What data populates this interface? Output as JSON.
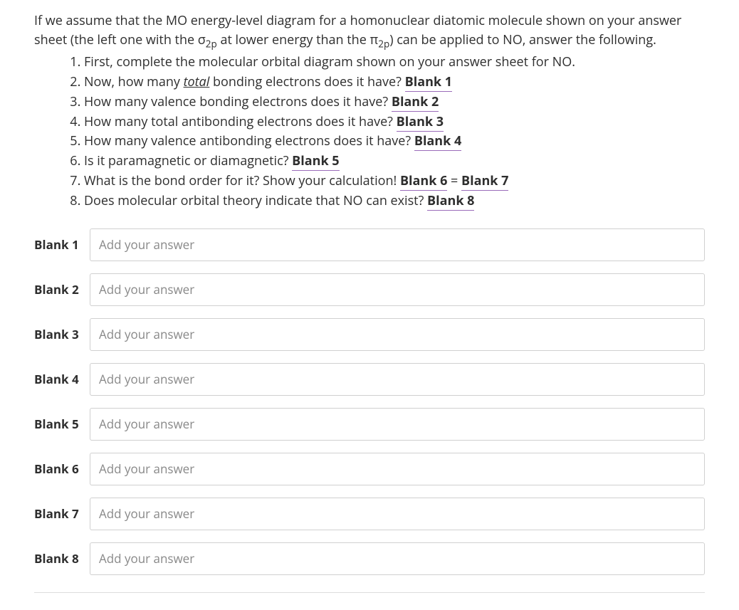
{
  "intro": {
    "line1_pre": "If we assume that the MO energy-level diagram for a homonuclear diatomic molecule shown on your answer sheet (the left one with the σ",
    "line1_sub1": "2p",
    "line1_mid": " at lower energy than the π",
    "line1_sub2": "2p",
    "line1_post": ") can be applied to NO, answer the following."
  },
  "questions": [
    {
      "pre": "First, complete the molecular orbital diagram shown on your answer sheet for NO.",
      "blank": null
    },
    {
      "pre": "Now, how many ",
      "ul_italic": "total",
      "mid": " bonding electrons does it have? ",
      "blank": "Blank 1"
    },
    {
      "pre": "How many valence bonding electrons does it have? ",
      "blank": "Blank 2"
    },
    {
      "pre": "How many total antibonding electrons does it have? ",
      "blank": "Blank 3"
    },
    {
      "pre": "How many valence antibonding electrons does it have? ",
      "blank": "Blank 4"
    },
    {
      "pre": "Is it paramagnetic or diamagnetic? ",
      "blank": "Blank 5"
    },
    {
      "pre": "What is the bond order for it? Show your calculation! ",
      "blank": "Blank 6",
      "sep": " = ",
      "blank2": "Blank 7"
    },
    {
      "pre": "Does molecular orbital theory indicate that NO can exist? ",
      "blank": "Blank 8"
    }
  ],
  "answers": [
    {
      "label": "Blank 1",
      "placeholder": "Add your answer"
    },
    {
      "label": "Blank 2",
      "placeholder": "Add your answer"
    },
    {
      "label": "Blank 3",
      "placeholder": "Add your answer"
    },
    {
      "label": "Blank 4",
      "placeholder": "Add your answer"
    },
    {
      "label": "Blank 5",
      "placeholder": "Add your answer"
    },
    {
      "label": "Blank 6",
      "placeholder": "Add your answer"
    },
    {
      "label": "Blank 7",
      "placeholder": "Add your answer"
    },
    {
      "label": "Blank 8",
      "placeholder": "Add your answer"
    }
  ]
}
